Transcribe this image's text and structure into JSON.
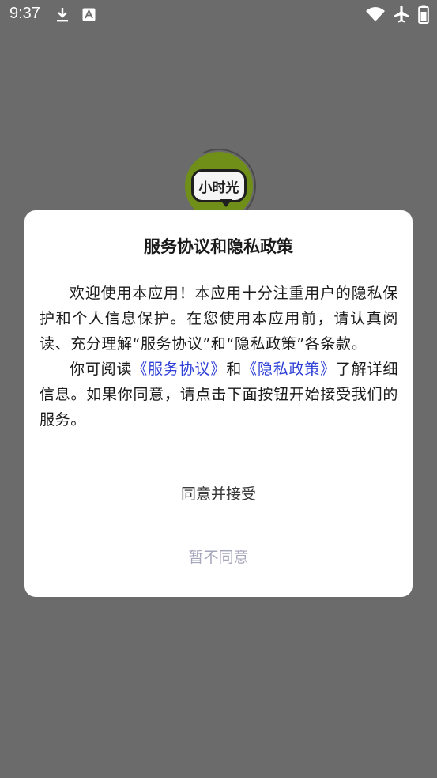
{
  "status_bar": {
    "time": "9:37",
    "icons": [
      "download-icon",
      "a-badge-icon",
      "wifi-icon",
      "airplane-icon",
      "battery-icon"
    ]
  },
  "logo": {
    "text": "小时光"
  },
  "dialog": {
    "title": "服务协议和隐私政策",
    "paragraph1": "欢迎使用本应用！本应用十分注重用户的隐私保护和个人信息保护。在您使用本应用前，请认真阅读、充分理解“服务协议”和“隐私政策”各条款。",
    "p2_prefix": "你可阅读",
    "service_link": "《服务协议》",
    "and_text": "和",
    "privacy_link": "《隐私政策》",
    "p2_suffix": "了解详细信息。如果你同意，请点击下面按钮开始接受我们的服务。",
    "agree_label": "同意并接受",
    "decline_label": "暂不同意"
  },
  "colors": {
    "overlay": "#6b6b6b",
    "link": "#2d3fd6",
    "decline": "#a6a6bb",
    "logo_green": "#6f8f18"
  }
}
